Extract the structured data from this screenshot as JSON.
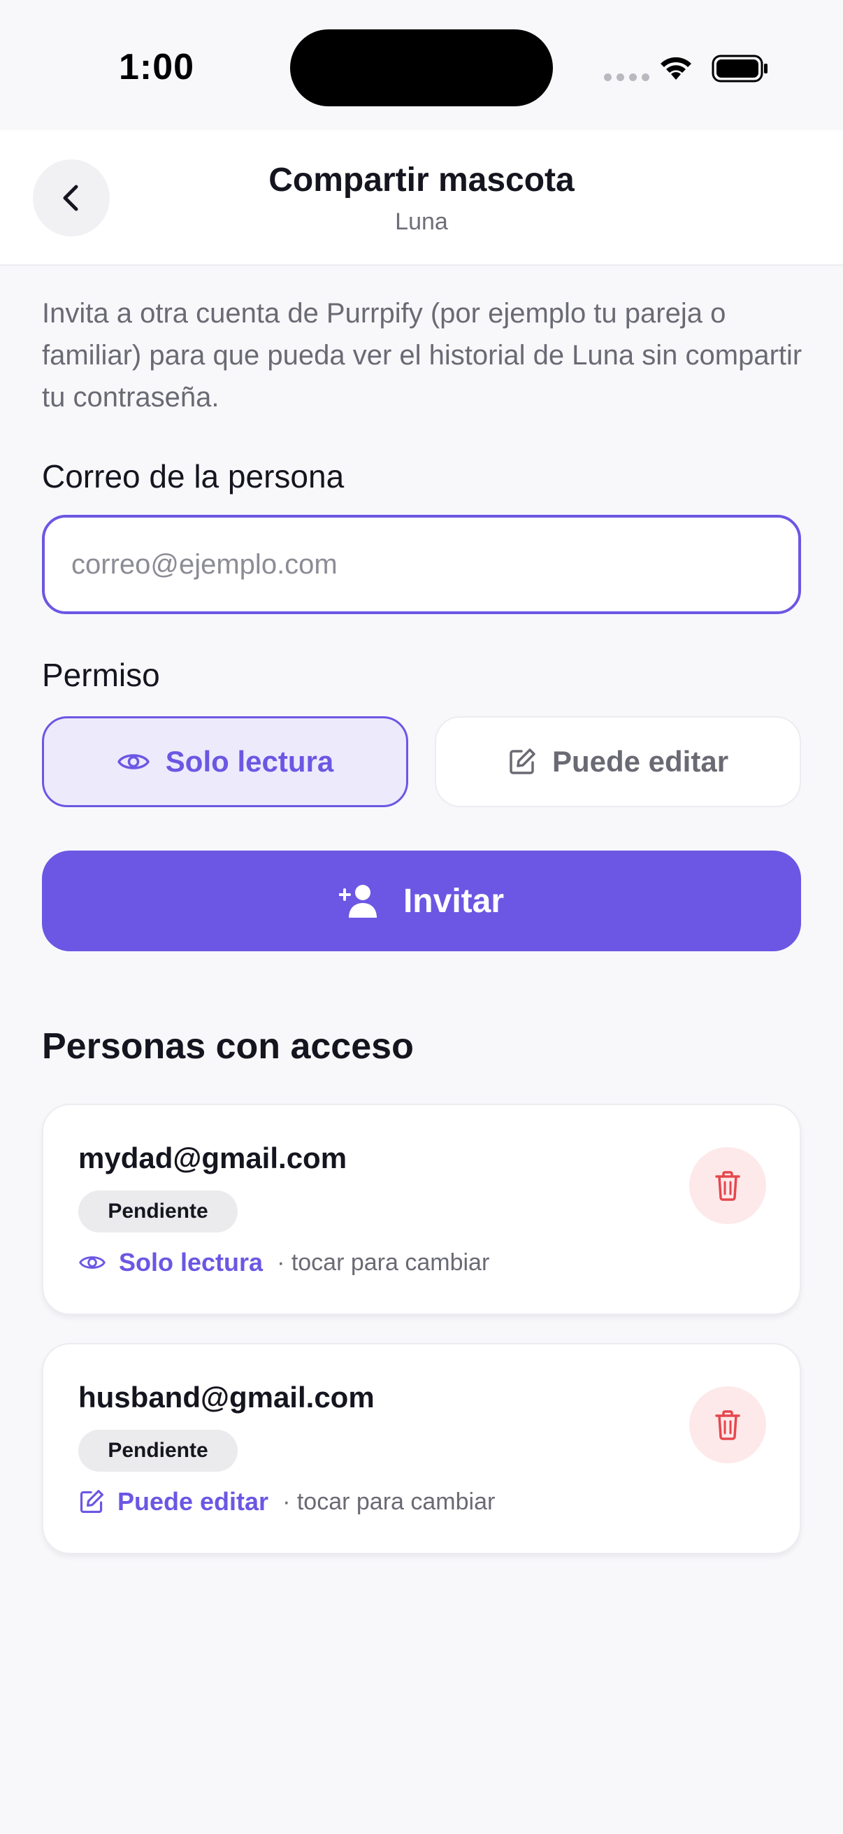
{
  "status_bar": {
    "time": "1:00"
  },
  "header": {
    "title": "Compartir mascota",
    "subtitle": "Luna"
  },
  "intro": "Invita a otra cuenta de Purrpify (por ejemplo tu pareja o familiar) para que pueda ver el historial de Luna sin compartir tu contraseña.",
  "email_field": {
    "label": "Correo de la persona",
    "value": "",
    "placeholder": "correo@ejemplo.com"
  },
  "permission": {
    "label": "Permiso",
    "options": [
      {
        "label": "Solo lectura",
        "selected": true
      },
      {
        "label": "Puede editar",
        "selected": false
      }
    ]
  },
  "invite_button": {
    "label": "Invitar"
  },
  "access_section": {
    "title": "Personas con acceso",
    "people": [
      {
        "email": "mydad@gmail.com",
        "status": "Pendiente",
        "permission": "Solo lectura",
        "hint": "· tocar para cambiar"
      },
      {
        "email": "husband@gmail.com",
        "status": "Pendiente",
        "permission": "Puede editar",
        "hint": "· tocar para cambiar"
      }
    ]
  },
  "colors": {
    "accent": "#6b57e3",
    "accent_light": "#edeafc",
    "danger": "#e5484d",
    "danger_light": "#fde9ea"
  }
}
